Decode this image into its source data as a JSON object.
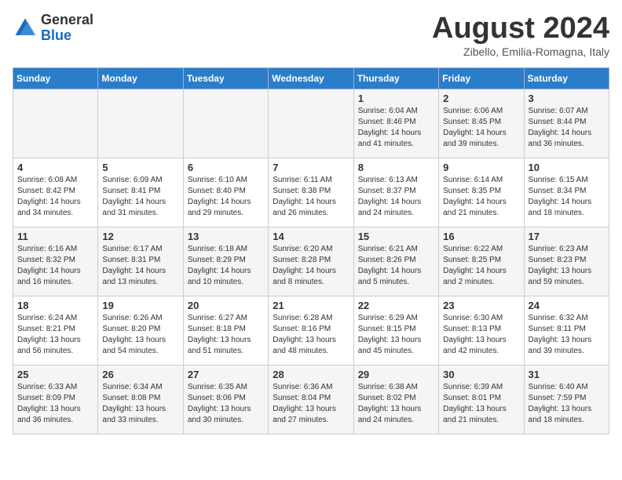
{
  "header": {
    "logo_general": "General",
    "logo_blue": "Blue",
    "month_title": "August 2024",
    "location": "Zibello, Emilia-Romagna, Italy"
  },
  "days_of_week": [
    "Sunday",
    "Monday",
    "Tuesday",
    "Wednesday",
    "Thursday",
    "Friday",
    "Saturday"
  ],
  "weeks": [
    [
      {
        "day": "",
        "info": ""
      },
      {
        "day": "",
        "info": ""
      },
      {
        "day": "",
        "info": ""
      },
      {
        "day": "",
        "info": ""
      },
      {
        "day": "1",
        "info": "Sunrise: 6:04 AM\nSunset: 8:46 PM\nDaylight: 14 hours\nand 41 minutes."
      },
      {
        "day": "2",
        "info": "Sunrise: 6:06 AM\nSunset: 8:45 PM\nDaylight: 14 hours\nand 39 minutes."
      },
      {
        "day": "3",
        "info": "Sunrise: 6:07 AM\nSunset: 8:44 PM\nDaylight: 14 hours\nand 36 minutes."
      }
    ],
    [
      {
        "day": "4",
        "info": "Sunrise: 6:08 AM\nSunset: 8:42 PM\nDaylight: 14 hours\nand 34 minutes."
      },
      {
        "day": "5",
        "info": "Sunrise: 6:09 AM\nSunset: 8:41 PM\nDaylight: 14 hours\nand 31 minutes."
      },
      {
        "day": "6",
        "info": "Sunrise: 6:10 AM\nSunset: 8:40 PM\nDaylight: 14 hours\nand 29 minutes."
      },
      {
        "day": "7",
        "info": "Sunrise: 6:11 AM\nSunset: 8:38 PM\nDaylight: 14 hours\nand 26 minutes."
      },
      {
        "day": "8",
        "info": "Sunrise: 6:13 AM\nSunset: 8:37 PM\nDaylight: 14 hours\nand 24 minutes."
      },
      {
        "day": "9",
        "info": "Sunrise: 6:14 AM\nSunset: 8:35 PM\nDaylight: 14 hours\nand 21 minutes."
      },
      {
        "day": "10",
        "info": "Sunrise: 6:15 AM\nSunset: 8:34 PM\nDaylight: 14 hours\nand 18 minutes."
      }
    ],
    [
      {
        "day": "11",
        "info": "Sunrise: 6:16 AM\nSunset: 8:32 PM\nDaylight: 14 hours\nand 16 minutes."
      },
      {
        "day": "12",
        "info": "Sunrise: 6:17 AM\nSunset: 8:31 PM\nDaylight: 14 hours\nand 13 minutes."
      },
      {
        "day": "13",
        "info": "Sunrise: 6:18 AM\nSunset: 8:29 PM\nDaylight: 14 hours\nand 10 minutes."
      },
      {
        "day": "14",
        "info": "Sunrise: 6:20 AM\nSunset: 8:28 PM\nDaylight: 14 hours\nand 8 minutes."
      },
      {
        "day": "15",
        "info": "Sunrise: 6:21 AM\nSunset: 8:26 PM\nDaylight: 14 hours\nand 5 minutes."
      },
      {
        "day": "16",
        "info": "Sunrise: 6:22 AM\nSunset: 8:25 PM\nDaylight: 14 hours\nand 2 minutes."
      },
      {
        "day": "17",
        "info": "Sunrise: 6:23 AM\nSunset: 8:23 PM\nDaylight: 13 hours\nand 59 minutes."
      }
    ],
    [
      {
        "day": "18",
        "info": "Sunrise: 6:24 AM\nSunset: 8:21 PM\nDaylight: 13 hours\nand 56 minutes."
      },
      {
        "day": "19",
        "info": "Sunrise: 6:26 AM\nSunset: 8:20 PM\nDaylight: 13 hours\nand 54 minutes."
      },
      {
        "day": "20",
        "info": "Sunrise: 6:27 AM\nSunset: 8:18 PM\nDaylight: 13 hours\nand 51 minutes."
      },
      {
        "day": "21",
        "info": "Sunrise: 6:28 AM\nSunset: 8:16 PM\nDaylight: 13 hours\nand 48 minutes."
      },
      {
        "day": "22",
        "info": "Sunrise: 6:29 AM\nSunset: 8:15 PM\nDaylight: 13 hours\nand 45 minutes."
      },
      {
        "day": "23",
        "info": "Sunrise: 6:30 AM\nSunset: 8:13 PM\nDaylight: 13 hours\nand 42 minutes."
      },
      {
        "day": "24",
        "info": "Sunrise: 6:32 AM\nSunset: 8:11 PM\nDaylight: 13 hours\nand 39 minutes."
      }
    ],
    [
      {
        "day": "25",
        "info": "Sunrise: 6:33 AM\nSunset: 8:09 PM\nDaylight: 13 hours\nand 36 minutes."
      },
      {
        "day": "26",
        "info": "Sunrise: 6:34 AM\nSunset: 8:08 PM\nDaylight: 13 hours\nand 33 minutes."
      },
      {
        "day": "27",
        "info": "Sunrise: 6:35 AM\nSunset: 8:06 PM\nDaylight: 13 hours\nand 30 minutes."
      },
      {
        "day": "28",
        "info": "Sunrise: 6:36 AM\nSunset: 8:04 PM\nDaylight: 13 hours\nand 27 minutes."
      },
      {
        "day": "29",
        "info": "Sunrise: 6:38 AM\nSunset: 8:02 PM\nDaylight: 13 hours\nand 24 minutes."
      },
      {
        "day": "30",
        "info": "Sunrise: 6:39 AM\nSunset: 8:01 PM\nDaylight: 13 hours\nand 21 minutes."
      },
      {
        "day": "31",
        "info": "Sunrise: 6:40 AM\nSunset: 7:59 PM\nDaylight: 13 hours\nand 18 minutes."
      }
    ]
  ]
}
